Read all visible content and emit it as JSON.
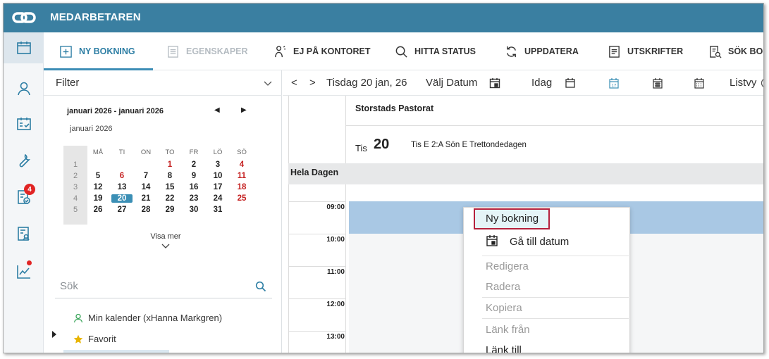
{
  "app": {
    "title": "MEDARBETAREN"
  },
  "leftnav": {
    "badge_count": "4"
  },
  "toolbar": {
    "new_booking": "NY BOKNING",
    "properties": "EGENSKAPER",
    "not_in_office": "EJ PÅ KONTORET",
    "find_status": "HITTA STATUS",
    "update": "UPPDATERA",
    "prints": "UTSKRIFTER",
    "search_booking": "SÖK BOK"
  },
  "filter": {
    "label": "Filter",
    "range": "januari 2026 - januari 2026",
    "month": "januari 2026",
    "weekdays": [
      "MÅ",
      "TI",
      "ON",
      "TO",
      "FR",
      "LÖ",
      "SÖ"
    ],
    "weeks": [
      "1",
      "2",
      "3",
      "4",
      "5"
    ],
    "days": [
      [
        "",
        "",
        "",
        "1",
        "2",
        "3",
        "4"
      ],
      [
        "5",
        "6",
        "7",
        "8",
        "9",
        "10",
        "11"
      ],
      [
        "12",
        "13",
        "14",
        "15",
        "16",
        "17",
        "18"
      ],
      [
        "19",
        "20",
        "21",
        "22",
        "23",
        "24",
        "25"
      ],
      [
        "26",
        "27",
        "28",
        "29",
        "30",
        "31",
        ""
      ]
    ],
    "show_more": "Visa mer",
    "search_placeholder": "Sök",
    "tree": {
      "my_calendar": "Min kalender (xHanna Markgren)",
      "favorite": "Favorit"
    }
  },
  "calendar_header": {
    "date": "Tisdag 20 jan, 26",
    "choose_date": "Välj Datum",
    "today": "Idag",
    "list_view": "Listvy"
  },
  "day": {
    "resource": "Storstads Pastorat",
    "weekday": "Tis",
    "daynum": "20",
    "info": "Tis E 2:A Sön E Trettondedagen",
    "all_day": "Hela Dagen",
    "hours": [
      "09:00",
      "10:00",
      "11:00",
      "12:00",
      "13:00"
    ]
  },
  "context_menu": {
    "new_booking": "Ny bokning",
    "go_to_date": "Gå till datum",
    "edit": "Redigera",
    "delete": "Radera",
    "copy": "Kopiera",
    "link_from": "Länk från",
    "link_to": "Länk till"
  },
  "colors": {
    "header": "#3a7fa1",
    "accent": "#3b8fb5",
    "booking": "#a9c8e4",
    "highlight_border": "#b5213c",
    "weekend_red": "#c41e1e"
  }
}
